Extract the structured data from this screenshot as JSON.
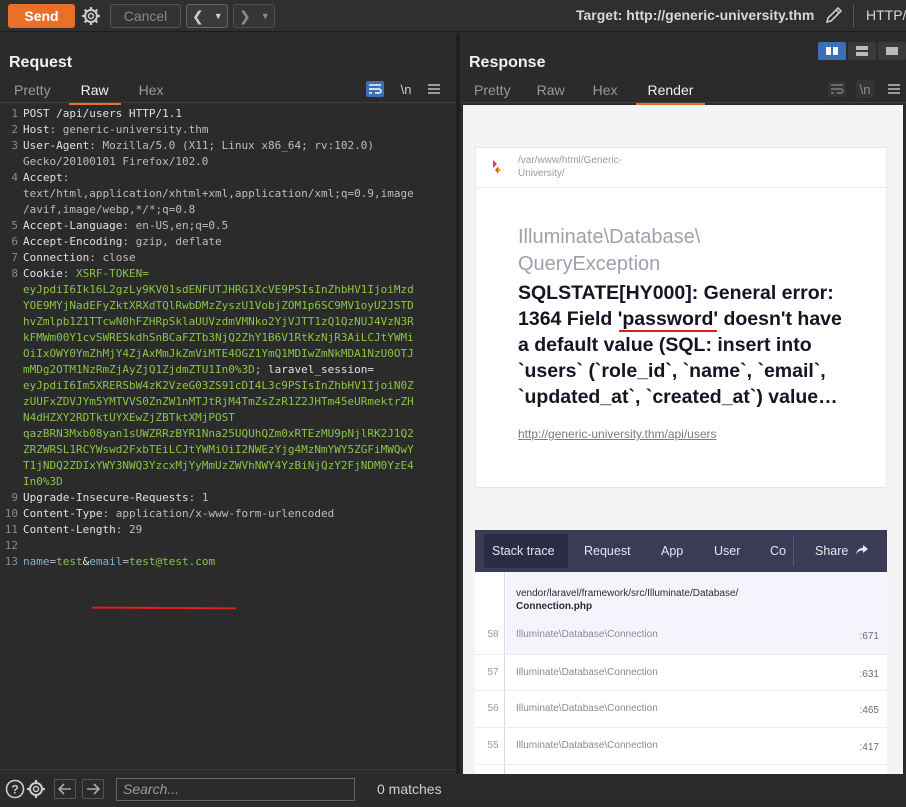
{
  "toolbar": {
    "send_label": "Send",
    "cancel_label": "Cancel",
    "target": "Target: http://generic-university.thm",
    "http_label": "HTTP/"
  },
  "request": {
    "title": "Request",
    "tabs": [
      "Pretty",
      "Raw",
      "Hex"
    ],
    "active_tab": "Raw",
    "newline_toggle": "\\n",
    "lines": [
      {
        "n": "1",
        "parts": [
          {
            "c": "k",
            "t": "POST /api/users HTTP/1.1"
          }
        ]
      },
      {
        "n": "2",
        "parts": [
          {
            "c": "k",
            "t": "Host"
          },
          {
            "c": "v",
            "t": ": generic-university.thm"
          }
        ]
      },
      {
        "n": "3",
        "parts": [
          {
            "c": "k",
            "t": "User-Agent"
          },
          {
            "c": "v",
            "t": ": Mozilla/5.0 (X11; Linux x86_64; rv:102.0)"
          }
        ]
      },
      {
        "n": "",
        "parts": [
          {
            "c": "v",
            "t": "Gecko/20100101 Firefox/102.0"
          }
        ]
      },
      {
        "n": "4",
        "parts": [
          {
            "c": "k",
            "t": "Accept"
          },
          {
            "c": "v",
            "t": ":"
          }
        ]
      },
      {
        "n": "",
        "parts": [
          {
            "c": "v",
            "t": "text/html,application/xhtml+xml,application/xml;q=0.9,image"
          }
        ]
      },
      {
        "n": "",
        "parts": [
          {
            "c": "v",
            "t": "/avif,image/webp,*/*;q=0.8"
          }
        ]
      },
      {
        "n": "5",
        "parts": [
          {
            "c": "k",
            "t": "Accept-Language"
          },
          {
            "c": "v",
            "t": ": en-US,en;q=0.5"
          }
        ]
      },
      {
        "n": "6",
        "parts": [
          {
            "c": "k",
            "t": "Accept-Encoding"
          },
          {
            "c": "v",
            "t": ": gzip, deflate"
          }
        ]
      },
      {
        "n": "7",
        "parts": [
          {
            "c": "k",
            "t": "Connection"
          },
          {
            "c": "v",
            "t": ": close"
          }
        ]
      },
      {
        "n": "8",
        "parts": [
          {
            "c": "k",
            "t": "Cookie"
          },
          {
            "c": "v",
            "t": ": "
          },
          {
            "c": "ck",
            "t": "XSRF-TOKEN="
          }
        ]
      },
      {
        "n": "",
        "parts": [
          {
            "c": "ck",
            "t": "eyJpdiI6Ik16L2gzLy9KV01sdENFUTJHRG1XcVE9PSIsInZhbHV1IjoiMzd"
          }
        ]
      },
      {
        "n": "",
        "parts": [
          {
            "c": "ck",
            "t": "YOE9MYjNadEFyZktXRXdTQlRwbDMzZyszU1VobjZOM1p6SC9MV1oyU2JSTD"
          }
        ]
      },
      {
        "n": "",
        "parts": [
          {
            "c": "ck",
            "t": "hvZmlpb1Z1TTcwN0hFZHRpSklaUUVzdmVMNko2YjVJTT1zQ1QzNUJ4VzN3R"
          }
        ]
      },
      {
        "n": "",
        "parts": [
          {
            "c": "ck",
            "t": "kFMWm00Y1cvSWRESkdhSnBCaFZTb3NjQ2ZhY1B6V1RtKzNjR3AiLCJtYWMi"
          }
        ]
      },
      {
        "n": "",
        "parts": [
          {
            "c": "ck",
            "t": "OiIxOWY0YmZhMjY4ZjAxMmJkZmViMTE4OGZ1YmQ1MDIwZmNkMDA1NzU0OTJ"
          }
        ]
      },
      {
        "n": "",
        "parts": [
          {
            "c": "ck",
            "t": "mMDg2OTM1NzRmZjAyZjQ1ZjdmZTU1In0%3D"
          },
          {
            "c": "v",
            "t": "; "
          },
          {
            "c": "k",
            "t": "laravel_session="
          }
        ]
      },
      {
        "n": "",
        "parts": [
          {
            "c": "ck",
            "t": "eyJpdiI6Im5XRERSbW4zK2VzeG03ZS91cDI4L3c9PSIsInZhbHV1IjoiN0Z"
          }
        ]
      },
      {
        "n": "",
        "parts": [
          {
            "c": "ck",
            "t": "zUUFxZDVJYm5YMTVVS0ZnZW1nMTJtRjM4TmZsZzR1Z2JHTm45eURmektrZH"
          }
        ]
      },
      {
        "n": "",
        "parts": [
          {
            "c": "ck",
            "t": "N4dHZXY2RDTktUYXEwZjZBTktXMjPOST"
          }
        ]
      },
      {
        "n": "",
        "parts": [
          {
            "c": "ck",
            "t": "qazBRN3Mxb08yan1sUWZRRzBYR1Nna25UQUhQZm0xRTEzMU9pNjlRK2J1Q2"
          }
        ]
      },
      {
        "n": "",
        "parts": [
          {
            "c": "ck",
            "t": "ZRZWRSL1RCYWswd2FxbTEiLCJtYWMiOiI2NWEzYjg4MzNmYWY5ZGFiMWQwY"
          }
        ]
      },
      {
        "n": "",
        "parts": [
          {
            "c": "ck",
            "t": "T1jNDQ2ZDIxYWY3NWQ3YzcxMjYyMmUzZWVhNWY4YzBiNjQzY2FjNDM0YzE4"
          }
        ]
      },
      {
        "n": "",
        "parts": [
          {
            "c": "ck",
            "t": "In0%3D"
          }
        ]
      },
      {
        "n": "9",
        "parts": [
          {
            "c": "k",
            "t": "Upgrade-Insecure-Requests"
          },
          {
            "c": "v",
            "t": ": 1"
          }
        ]
      },
      {
        "n": "10",
        "parts": [
          {
            "c": "k",
            "t": "Content-Type"
          },
          {
            "c": "v",
            "t": ": application/x-www-form-urlencoded"
          }
        ]
      },
      {
        "n": "11",
        "parts": [
          {
            "c": "k",
            "t": "Content-Length"
          },
          {
            "c": "v",
            "t": ": 29"
          }
        ]
      },
      {
        "n": "12",
        "parts": []
      },
      {
        "n": "13",
        "parts": [
          {
            "c": "pn",
            "t": "name"
          },
          {
            "c": "v",
            "t": "="
          },
          {
            "c": "ck",
            "t": "test"
          },
          {
            "c": "k",
            "t": "&"
          },
          {
            "c": "pn",
            "t": "email"
          },
          {
            "c": "v",
            "t": "="
          },
          {
            "c": "ck",
            "t": "test@test.com"
          }
        ]
      }
    ]
  },
  "footer": {
    "search_placeholder": "Search...",
    "matches": "0 matches"
  },
  "response": {
    "title": "Response",
    "tabs": [
      "Pretty",
      "Raw",
      "Hex",
      "Render"
    ],
    "active_tab": "Render",
    "newline_toggle": "\\n",
    "render": {
      "path_line1": "/var/www/html/Generic-",
      "path_line2": "University/",
      "exception_line1": "Illuminate\\Database\\",
      "exception_line2": "QueryException",
      "error_line1": "SQLSTATE[HY000]: General error:",
      "error_line2a": "1364 Field ",
      "error_highlight": "'password'",
      "error_line2b": " doesn't have",
      "error_line3": "a default value (SQL: insert into",
      "error_line4": "`users` (`role_id`, `name`, `email`,",
      "error_line5": "`updated_at`, `created_at`) value…",
      "url": "http://generic-university.thm/api/users",
      "stack_tabs": [
        "Stack trace",
        "Request",
        "App",
        "User",
        "Co"
      ],
      "share_label": "Share",
      "frame_path_line1": "vendor/laravel/framework/src/Illuminate/Database/",
      "frame_path_line2": "Connection.php",
      "frames": [
        {
          "num": "58",
          "cls": "Illuminate\\Database\\Connection",
          "line": ":671"
        },
        {
          "num": "57",
          "cls": "Illuminate\\Database\\Connection",
          "line": ":631"
        },
        {
          "num": "56",
          "cls": "Illuminate\\Database\\Connection",
          "line": ":465"
        },
        {
          "num": "55",
          "cls": "Illuminate\\Database\\Connection",
          "line": ":417"
        }
      ]
    }
  },
  "colors": {
    "accent": "#e8702a",
    "annotation_red": "#e0201c",
    "cookie_green": "#8bc34a",
    "stack_bar": "#3c3b57"
  }
}
